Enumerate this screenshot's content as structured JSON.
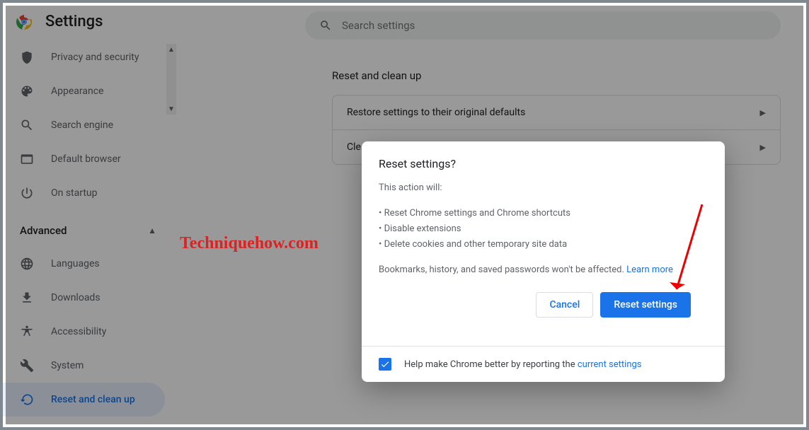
{
  "header": {
    "title": "Settings"
  },
  "search": {
    "placeholder": "Search settings"
  },
  "sidebar": {
    "items": [
      {
        "label": "Privacy and security"
      },
      {
        "label": "Appearance"
      },
      {
        "label": "Search engine"
      },
      {
        "label": "Default browser"
      },
      {
        "label": "On startup"
      }
    ],
    "advanced_label": "Advanced",
    "advanced_items": [
      {
        "label": "Languages"
      },
      {
        "label": "Downloads"
      },
      {
        "label": "Accessibility"
      },
      {
        "label": "System"
      },
      {
        "label": "Reset and clean up"
      }
    ]
  },
  "main": {
    "section_title": "Reset and clean up",
    "rows": [
      {
        "label": "Restore settings to their original defaults"
      },
      {
        "label": "Clean up computer"
      }
    ]
  },
  "dialog": {
    "title": "Reset settings?",
    "intro": "This action will:",
    "bullet1": "• Reset Chrome settings and Chrome shortcuts",
    "bullet2": "• Disable extensions",
    "bullet3": "• Delete cookies and other temporary site data",
    "outro": "Bookmarks, history, and saved passwords won't be affected. ",
    "learn_more": "Learn more",
    "cancel": "Cancel",
    "confirm": "Reset settings",
    "footer_text": "Help make Chrome better by reporting the ",
    "footer_link": "current settings"
  },
  "watermark": "Techniquehow.com"
}
